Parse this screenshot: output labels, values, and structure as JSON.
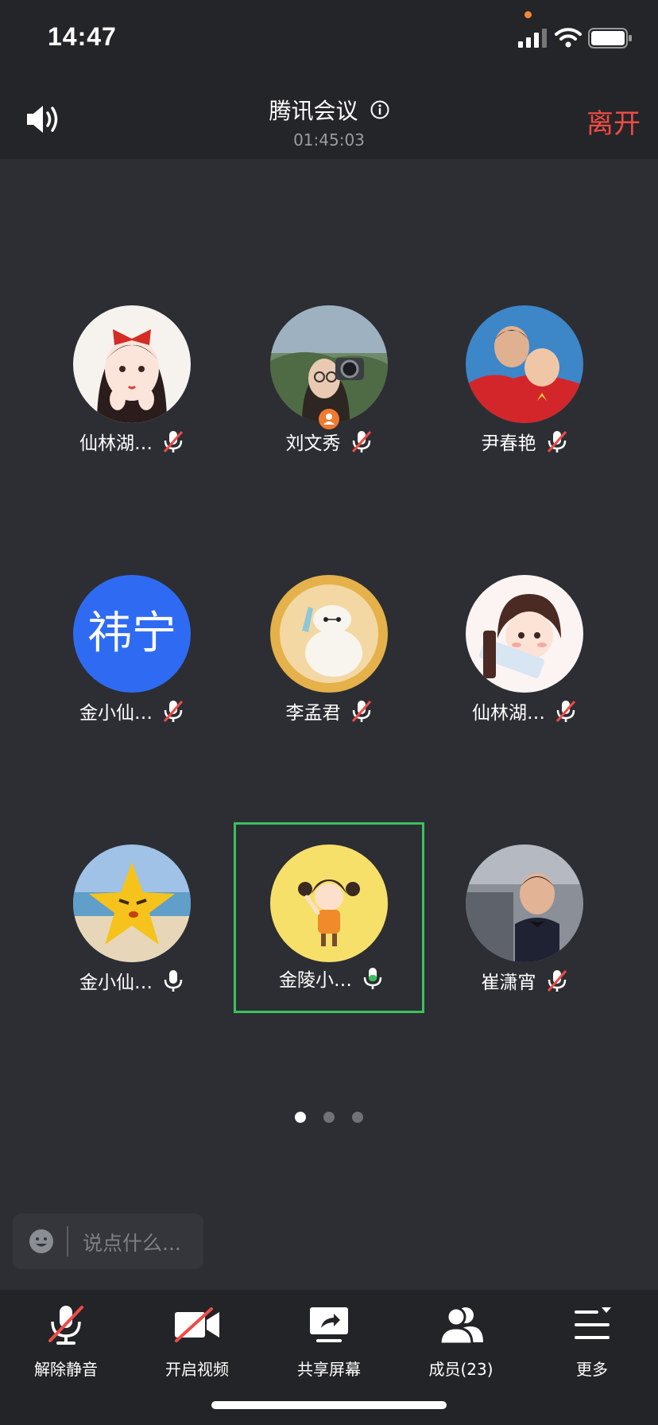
{
  "status_bar": {
    "time": "14:47",
    "icons": [
      "signal-icon",
      "wifi-icon",
      "battery-icon"
    ],
    "indicator_color": "#f0883a"
  },
  "header": {
    "title": "腾讯会议",
    "timer": "01:45:03",
    "leave_label": "离开",
    "leave_color": "#ef4b45"
  },
  "participants": [
    {
      "name": "仙林湖…",
      "mic": "muted"
    },
    {
      "name": "刘文秀",
      "mic": "muted",
      "host": true
    },
    {
      "name": "尹春艳",
      "mic": "muted"
    },
    {
      "name": "金小仙…",
      "mic": "muted",
      "avatar_text": "祎宁"
    },
    {
      "name": "李孟君",
      "mic": "muted"
    },
    {
      "name": "仙林湖…",
      "mic": "muted"
    },
    {
      "name": "金小仙…",
      "mic": "on"
    },
    {
      "name": "金陵小…",
      "mic": "speaking",
      "active_speaker": true
    },
    {
      "name": "崔潇宵",
      "mic": "muted"
    }
  ],
  "pager": {
    "pages": 3,
    "current": 1
  },
  "chat": {
    "placeholder": "说点什么..."
  },
  "toolbar": {
    "unmute_label": "解除静音",
    "video_label": "开启视频",
    "share_label": "共享屏幕",
    "members_label": "成员(23)",
    "more_label": "更多"
  },
  "colors": {
    "background": "#2c2e33",
    "bar": "#232427",
    "active_border": "#3bc15c",
    "mute_slash": "#ef4b45",
    "avatar_blue": "#2f6bf2"
  }
}
